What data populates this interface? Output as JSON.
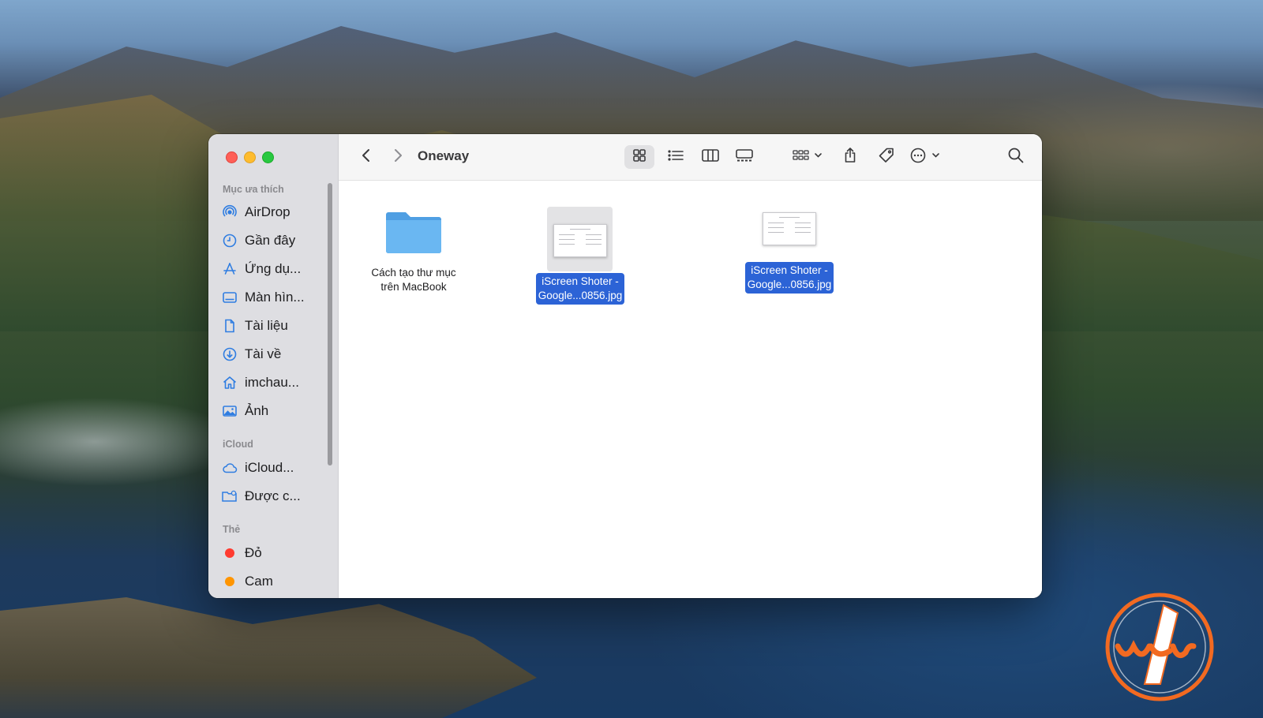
{
  "window": {
    "title": "Oneway"
  },
  "sidebar": {
    "favorites_header": "Mục ưa thích",
    "favorites": [
      {
        "label": "AirDrop",
        "icon": "airdrop-icon"
      },
      {
        "label": "Gần đây",
        "icon": "clock-icon"
      },
      {
        "label": "Ứng dụ...",
        "icon": "applications-icon"
      },
      {
        "label": "Màn hìn...",
        "icon": "desktop-icon"
      },
      {
        "label": "Tài liệu",
        "icon": "document-icon"
      },
      {
        "label": "Tài về",
        "icon": "download-icon"
      },
      {
        "label": "imchau...",
        "icon": "home-icon"
      },
      {
        "label": "Ảnh",
        "icon": "photo-icon"
      }
    ],
    "icloud_header": "iCloud",
    "icloud": [
      {
        "label": "iCloud...",
        "icon": "cloud-icon"
      },
      {
        "label": "Được c...",
        "icon": "shared-folder-icon"
      }
    ],
    "tags_header": "Thẻ",
    "tags": [
      {
        "label": "Đỏ",
        "color": "#ff3b30"
      },
      {
        "label": "Cam",
        "color": "#ff9500"
      }
    ]
  },
  "toolbar": {
    "icons": [
      "chevron-left-icon",
      "chevron-right-icon",
      "grid-view-icon",
      "list-view-icon",
      "column-view-icon",
      "gallery-view-icon",
      "group-icon",
      "share-icon",
      "tag-icon",
      "more-icon",
      "search-icon"
    ]
  },
  "files": [
    {
      "line1": "Cách tạo thư mục",
      "line2": "trên MacBook",
      "kind": "folder",
      "selected": false
    },
    {
      "line1": "iScreen Shoter -",
      "line2": "Google...0856.jpg",
      "kind": "image",
      "selected": true
    },
    {
      "line1": "iScreen Shoter -",
      "line2": "Google...0856.jpg",
      "kind": "image",
      "selected": true
    }
  ],
  "colors": {
    "accent": "#2c63d6",
    "folder": "#5aa9ea",
    "logo": "#f26a21"
  }
}
